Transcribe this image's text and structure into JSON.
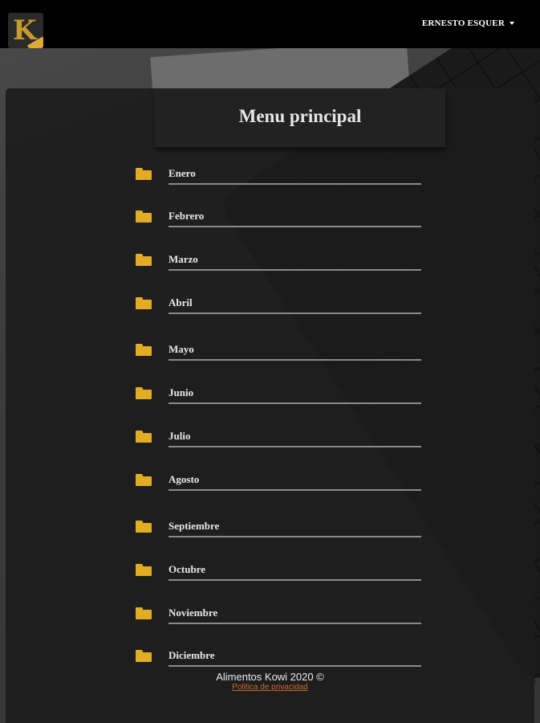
{
  "navbar": {
    "logo_letter": "K",
    "user_name": "ERNESTO ESQUER"
  },
  "main": {
    "title": "Menu principal",
    "months": [
      {
        "label": "Enero",
        "icon": "folder-icon"
      },
      {
        "label": "Febrero",
        "icon": "folder-icon"
      },
      {
        "label": "Marzo",
        "icon": "folder-icon"
      },
      {
        "label": "Abril",
        "icon": "folder-icon"
      },
      {
        "label": "Mayo",
        "icon": "folder-icon"
      },
      {
        "label": "Junio",
        "icon": "folder-icon"
      },
      {
        "label": "Julio",
        "icon": "folder-icon"
      },
      {
        "label": "Agosto",
        "icon": "folder-icon"
      },
      {
        "label": "Septiembre",
        "icon": "folder-icon"
      },
      {
        "label": "Octubre",
        "icon": "folder-icon"
      },
      {
        "label": "Noviembre",
        "icon": "folder-icon"
      },
      {
        "label": "Diciembre",
        "icon": "folder-icon"
      }
    ]
  },
  "footer": {
    "copyright": "Alimentos Kowi 2020 ©",
    "privacy_link": "Politica de privacidad"
  },
  "colors": {
    "accent": "#e2ac24",
    "link": "#c96a2a",
    "navbar": "#000000"
  }
}
